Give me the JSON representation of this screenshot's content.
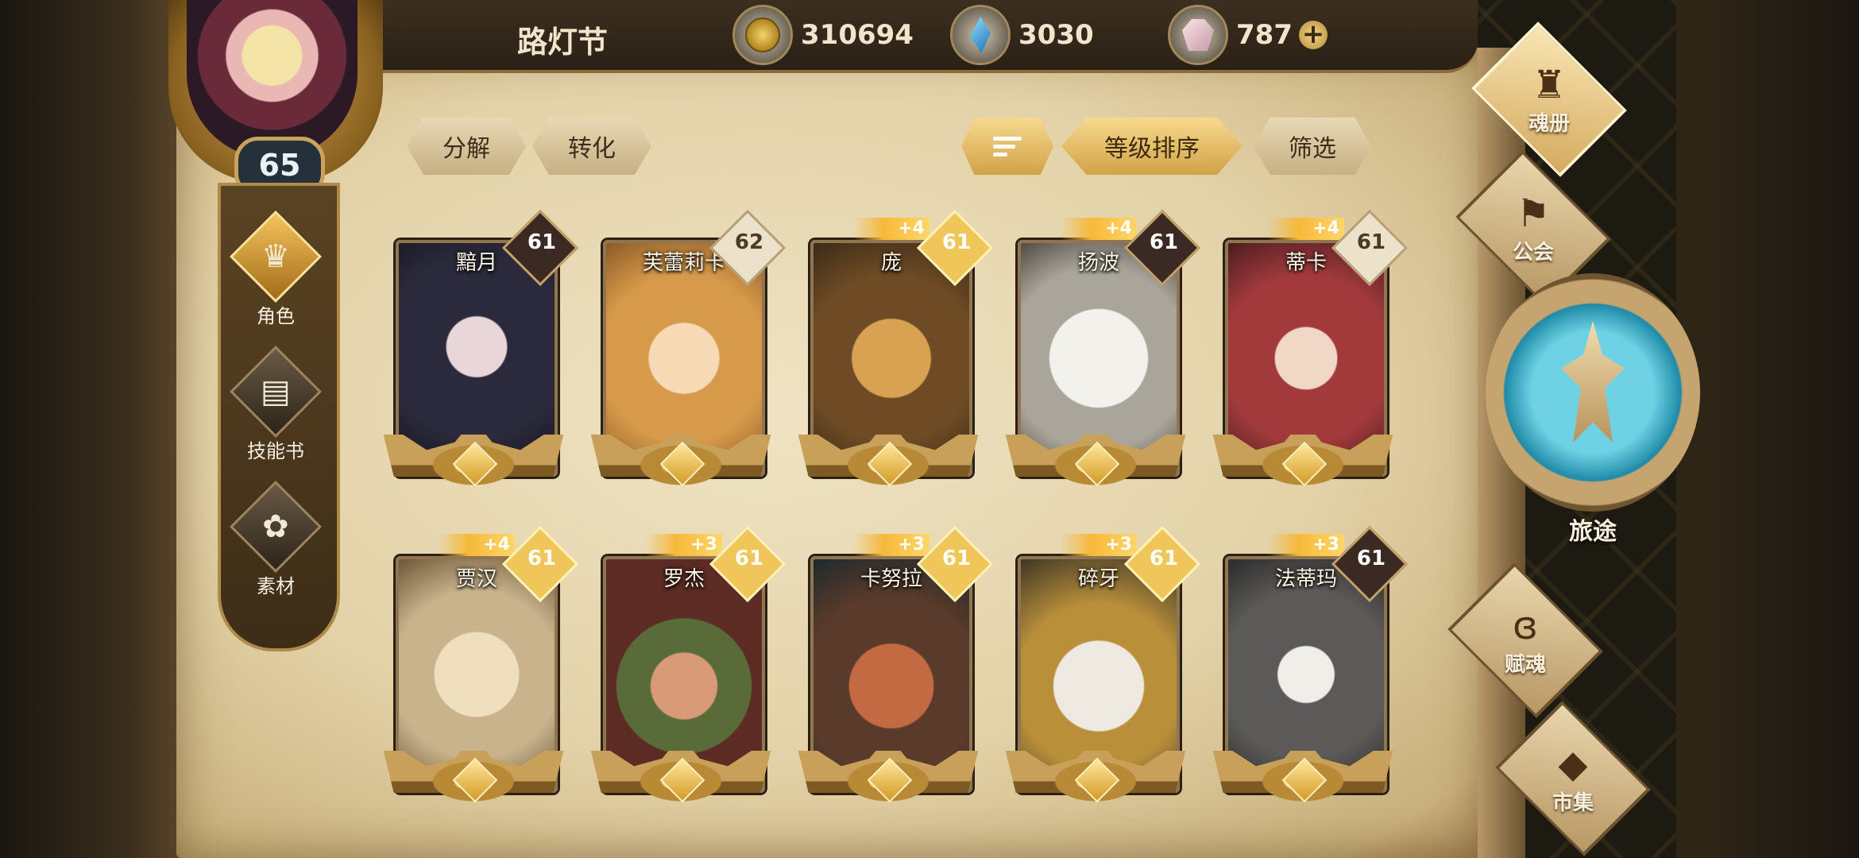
{
  "header": {
    "title": "路灯节",
    "gold": "310694",
    "crystal": "3030",
    "gem": "787",
    "add_symbol": "+"
  },
  "player": {
    "level": "65"
  },
  "leftnav": [
    {
      "label": "角色",
      "icon": "helmet-icon",
      "active": true
    },
    {
      "label": "技能书",
      "icon": "book-icon",
      "active": false
    },
    {
      "label": "素材",
      "icon": "material-icon",
      "active": false
    }
  ],
  "toolbar": {
    "decompose": "分解",
    "convert": "转化",
    "sort": "等级排序",
    "filter": "筛选"
  },
  "cards": [
    {
      "name": "黯月",
      "level": "61",
      "plus": "",
      "badge": "dark"
    },
    {
      "name": "芙蕾莉卡",
      "level": "62",
      "plus": "",
      "badge": "light"
    },
    {
      "name": "庞",
      "level": "61",
      "plus": "+4",
      "badge": "gold"
    },
    {
      "name": "扬波",
      "level": "61",
      "plus": "+4",
      "badge": "dark"
    },
    {
      "name": "蒂卡",
      "level": "61",
      "plus": "+4",
      "badge": "light"
    },
    {
      "name": "贾汉",
      "level": "61",
      "plus": "+4",
      "badge": "gold"
    },
    {
      "name": "罗杰",
      "level": "61",
      "plus": "+3",
      "badge": "gold"
    },
    {
      "name": "卡努拉",
      "level": "61",
      "plus": "+3",
      "badge": "gold"
    },
    {
      "name": "碎牙",
      "level": "61",
      "plus": "+3",
      "badge": "gold"
    },
    {
      "name": "法蒂玛",
      "level": "61",
      "plus": "+3",
      "badge": "dark"
    }
  ],
  "rightmenu": {
    "soulbook": "魂册",
    "guild": "公会",
    "journey": "旅途",
    "endow": "赋魂",
    "market": "市集"
  },
  "colors": {
    "accent_gold": "#f0c65a",
    "parchment": "#e3d2a8",
    "journey_teal": "#1f8aa8"
  }
}
